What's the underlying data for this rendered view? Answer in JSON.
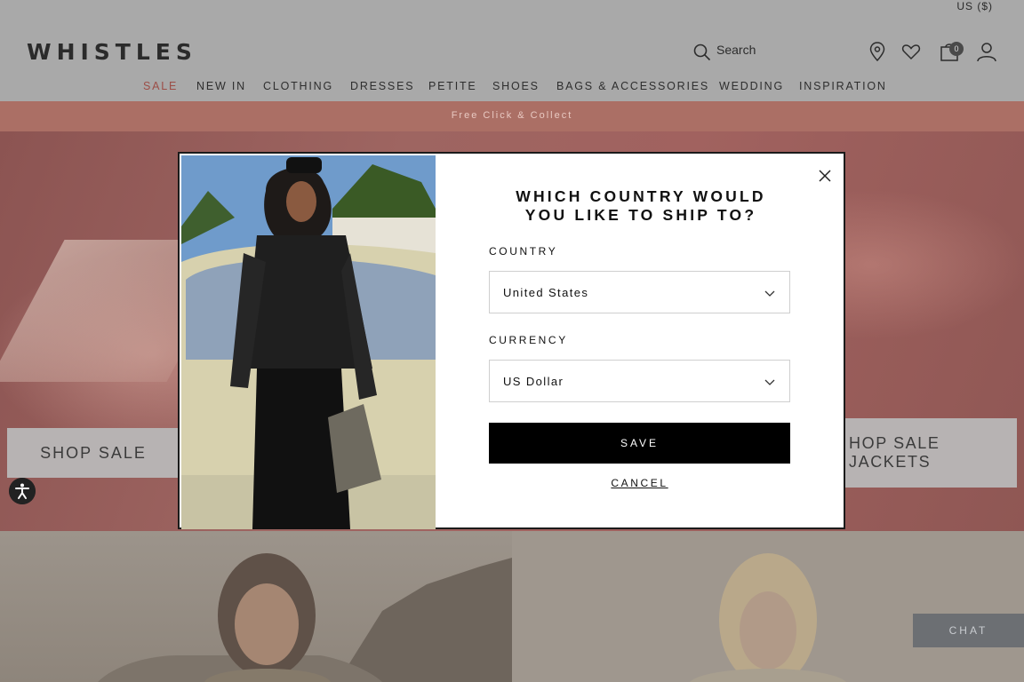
{
  "header": {
    "region": "US ($)",
    "logo": "WHISTLES",
    "search_label": "Search",
    "bag_count": "0",
    "icons": [
      "search-icon",
      "location-pin-icon",
      "heart-icon",
      "shopping-bag-icon",
      "user-icon"
    ]
  },
  "nav": {
    "items": [
      {
        "label": "SALE"
      },
      {
        "label": "NEW IN"
      },
      {
        "label": "CLOTHING"
      },
      {
        "label": "DRESSES"
      },
      {
        "label": "PETITE"
      },
      {
        "label": "SHOES"
      },
      {
        "label": "BAGS & ACCESSORIES"
      },
      {
        "label": "WEDDING"
      },
      {
        "label": "INSPIRATION"
      }
    ],
    "sale_color": "#9c4e47"
  },
  "promo": {
    "text": "Free Click & Collect",
    "background": "#ab6f65"
  },
  "hero": {
    "shop_sale": "SHOP SALE",
    "shop_sale_jackets_line1": "HOP SALE",
    "shop_sale_jackets_line2": "JACKETS"
  },
  "chat": {
    "label": "CHAT"
  },
  "modal": {
    "title_line1": "WHICH COUNTRY WOULD",
    "title_line2": "YOU LIKE TO SHIP TO?",
    "country_label": "COUNTRY",
    "country_value": "United States",
    "currency_label": "CURRENCY",
    "currency_value": "US Dollar",
    "save_label": "SAVE",
    "cancel_label": "CANCEL"
  }
}
